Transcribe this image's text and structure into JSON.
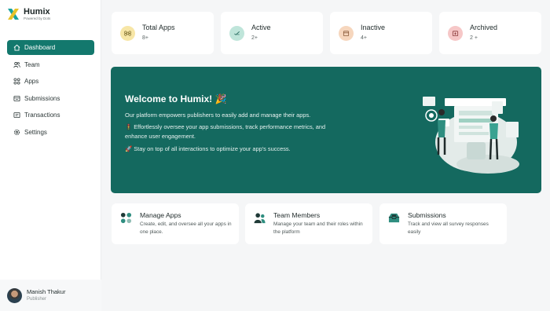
{
  "brand": {
    "name": "Humix",
    "tagline": "Powered by Dots"
  },
  "sidebar": {
    "items": [
      {
        "label": "Dashboard",
        "icon": "home-icon",
        "active": true
      },
      {
        "label": "Team",
        "icon": "users-icon",
        "active": false
      },
      {
        "label": "Apps",
        "icon": "apps-icon",
        "active": false
      },
      {
        "label": "Submissions",
        "icon": "inbox-icon",
        "active": false
      },
      {
        "label": "Transactions",
        "icon": "receipt-icon",
        "active": false
      },
      {
        "label": "Settings",
        "icon": "gear-icon",
        "active": false
      }
    ]
  },
  "user": {
    "name": "Manish Thakur",
    "role": "Publisher"
  },
  "stats": [
    {
      "label": "Total Apps",
      "count": "8+",
      "icon": "command-icon",
      "color": "#f7e6a6"
    },
    {
      "label": "Active",
      "count": "2+",
      "icon": "check-icon",
      "color": "#bfe5da"
    },
    {
      "label": "Inactive",
      "count": "4+",
      "icon": "box-icon",
      "color": "#f6d6bd"
    },
    {
      "label": "Archived",
      "count": "2 +",
      "icon": "archive-icon",
      "color": "#f6c7c7"
    }
  ],
  "hero": {
    "title": "Welcome to Humix! 🎉",
    "line1": "Our platform empowers publishers to easily add and manage their apps.",
    "line2": "🚦 Effortlessly oversee your app submissions, track performance metrics, and enhance user engagement.",
    "line3": "🚀 Stay on top of all interactions to optimize your app's success."
  },
  "features": [
    {
      "title": "Manage Apps",
      "desc": "Create, edit, and oversee all your apps in one place.",
      "icon": "apps-grid-icon"
    },
    {
      "title": "Team Members",
      "desc": "Manage your team and their roles within the platform",
      "icon": "team-icon"
    },
    {
      "title": "Submissions",
      "desc": "Track and view all survey responses easily",
      "icon": "inbox-tray-icon"
    }
  ],
  "colors": {
    "accent": "#13786d",
    "hero_bg": "#14695f",
    "page_bg": "#f5f6f7"
  }
}
